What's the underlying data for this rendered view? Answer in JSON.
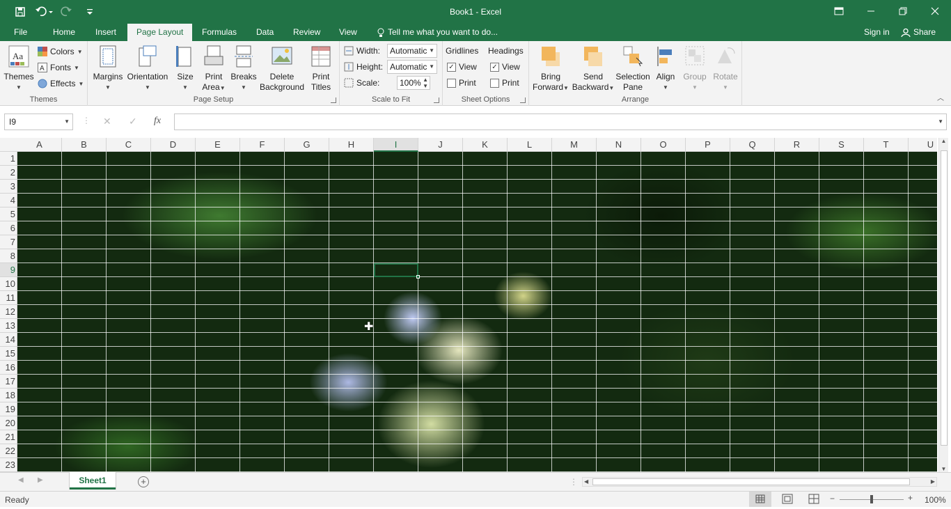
{
  "window": {
    "title": "Book1 - Excel"
  },
  "tabs": [
    "File",
    "Home",
    "Insert",
    "Page Layout",
    "Formulas",
    "Data",
    "Review",
    "View"
  ],
  "active_tab": "Page Layout",
  "tell_me": "Tell me what you want to do...",
  "account": {
    "sign_in": "Sign in",
    "share": "Share"
  },
  "ribbon": {
    "themes": {
      "themes_label": "Themes",
      "colors": "Colors",
      "fonts": "Fonts",
      "effects": "Effects",
      "group": "Themes"
    },
    "page_setup": {
      "margins": "Margins",
      "orientation": "Orientation",
      "size": "Size",
      "print_area_1": "Print",
      "print_area_2": "Area",
      "breaks": "Breaks",
      "delete_bg_1": "Delete",
      "delete_bg_2": "Background",
      "print_titles_1": "Print",
      "print_titles_2": "Titles",
      "group": "Page Setup"
    },
    "scale": {
      "width_label": "Width:",
      "width_value": "Automatic",
      "height_label": "Height:",
      "height_value": "Automatic",
      "scale_label": "Scale:",
      "scale_value": "100%",
      "group": "Scale to Fit"
    },
    "sheet_options": {
      "gridlines": "Gridlines",
      "headings": "Headings",
      "view": "View",
      "print": "Print",
      "group": "Sheet Options"
    },
    "arrange": {
      "bring_1": "Bring",
      "bring_2": "Forward",
      "send_1": "Send",
      "send_2": "Backward",
      "selection_1": "Selection",
      "selection_2": "Pane",
      "align": "Align",
      "group_btn": "Group",
      "rotate": "Rotate",
      "group": "Arrange"
    }
  },
  "namebox": "I9",
  "fx": "fx",
  "columns": [
    "A",
    "B",
    "C",
    "D",
    "E",
    "F",
    "G",
    "H",
    "I",
    "J",
    "K",
    "L",
    "M",
    "N",
    "O",
    "P",
    "Q",
    "R",
    "S",
    "T",
    "U"
  ],
  "rows": [
    "1",
    "2",
    "3",
    "4",
    "5",
    "6",
    "7",
    "8",
    "9",
    "10",
    "11",
    "12",
    "13",
    "14",
    "15",
    "16",
    "17",
    "18",
    "19",
    "20",
    "21",
    "22",
    "23"
  ],
  "selected_col": "I",
  "selected_row": "9",
  "sheet_tab": "Sheet1",
  "status": {
    "ready": "Ready",
    "zoom": "100%"
  }
}
